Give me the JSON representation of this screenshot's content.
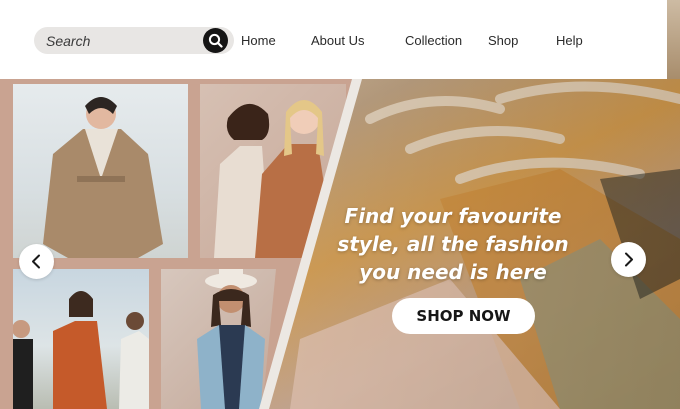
{
  "header": {
    "search": {
      "placeholder": "Search",
      "icon": "search-icon"
    },
    "nav": [
      "Home",
      "About Us",
      "Collection",
      "Shop",
      "Help"
    ]
  },
  "hero": {
    "headline_lines": [
      "Find your favourite",
      "style, all the fashion",
      "you need is here"
    ],
    "cta_label": "SHOP NOW",
    "prev_icon": "chevron-left-icon",
    "next_icon": "chevron-right-icon"
  },
  "colors": {
    "panel_background": "#c9a391",
    "search_field": "#e8e6e4",
    "search_button": "#151515",
    "cta_background": "#ffffff",
    "headline_text": "#ffffff"
  }
}
